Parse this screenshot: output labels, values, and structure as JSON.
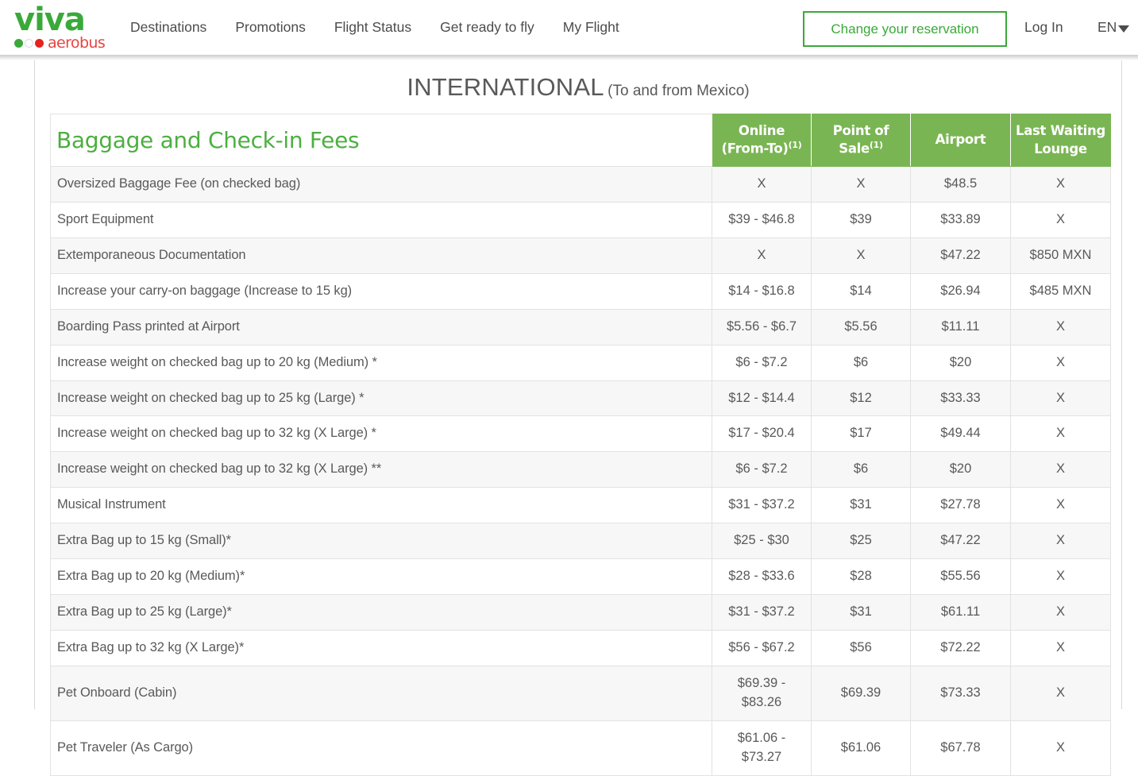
{
  "brand": {
    "logo_word": "viva",
    "logo_sub": "aerobus",
    "logo_green": "#3aa93a",
    "logo_red": "#e8433f"
  },
  "header": {
    "nav": [
      {
        "label": "Destinations",
        "name": "nav-destinations"
      },
      {
        "label": "Promotions",
        "name": "nav-promotions"
      },
      {
        "label": "Flight Status",
        "name": "nav-flight-status"
      },
      {
        "label": "Get ready to fly",
        "name": "nav-get-ready-to-fly"
      },
      {
        "label": "My Flight",
        "name": "nav-my-flight"
      }
    ],
    "change_reservation": "Change your reservation",
    "login": "Log In",
    "language": "EN"
  },
  "page": {
    "title_main": "INTERNATIONAL",
    "title_sub": "(To and from Mexico)"
  },
  "table": {
    "caption": "Baggage and Check-in Fees",
    "accent_green": "#7ab553",
    "title_green": "#4caf41",
    "columns": [
      {
        "line1": "Online",
        "line2": "(From-To)",
        "sup": "(1)"
      },
      {
        "line1": "Point of Sale",
        "line2": "",
        "sup": "(1)"
      },
      {
        "line1": "Airport",
        "line2": "",
        "sup": ""
      },
      {
        "line1": "Last Waiting",
        "line2": "Lounge",
        "sup": ""
      }
    ],
    "rows": [
      {
        "label": "Oversized Baggage Fee (on checked bag)",
        "online": "X",
        "point_of_sale": "X",
        "airport": "$48.5",
        "last_waiting_lounge": "X"
      },
      {
        "label": "Sport Equipment",
        "online": "$39 - $46.8",
        "point_of_sale": "$39",
        "airport": "$33.89",
        "last_waiting_lounge": "X"
      },
      {
        "label": "Extemporaneous Documentation",
        "online": "X",
        "point_of_sale": "X",
        "airport": "$47.22",
        "last_waiting_lounge": "$850 MXN"
      },
      {
        "label": "Increase your carry-on baggage (Increase to 15 kg)",
        "online": "$14 - $16.8",
        "point_of_sale": "$14",
        "airport": "$26.94",
        "last_waiting_lounge": "$485 MXN"
      },
      {
        "label": "Boarding Pass printed at Airport",
        "online": "$5.56 - $6.7",
        "point_of_sale": "$5.56",
        "airport": "$11.11",
        "last_waiting_lounge": "X"
      },
      {
        "label": "Increase weight on checked bag up to 20 kg (Medium) *",
        "online": "$6 - $7.2",
        "point_of_sale": "$6",
        "airport": "$20",
        "last_waiting_lounge": "X"
      },
      {
        "label": "Increase weight on checked bag up to 25 kg (Large) *",
        "online": "$12 - $14.4",
        "point_of_sale": "$12",
        "airport": "$33.33",
        "last_waiting_lounge": "X"
      },
      {
        "label": "Increase weight on checked bag up to 32 kg (X Large) *",
        "online": "$17 - $20.4",
        "point_of_sale": "$17",
        "airport": "$49.44",
        "last_waiting_lounge": "X"
      },
      {
        "label": "Increase weight on checked bag up to 32 kg (X Large) **",
        "online": "$6 - $7.2",
        "point_of_sale": "$6",
        "airport": "$20",
        "last_waiting_lounge": "X"
      },
      {
        "label": "Musical Instrument",
        "online": "$31 - $37.2",
        "point_of_sale": "$31",
        "airport": "$27.78",
        "last_waiting_lounge": "X"
      },
      {
        "label": "Extra Bag up to 15 kg (Small)*",
        "online": "$25 - $30",
        "point_of_sale": "$25",
        "airport": "$47.22",
        "last_waiting_lounge": "X"
      },
      {
        "label": "Extra Bag up to 20 kg (Medium)*",
        "online": "$28 - $33.6",
        "point_of_sale": "$28",
        "airport": "$55.56",
        "last_waiting_lounge": "X"
      },
      {
        "label": "Extra Bag up to 25 kg (Large)*",
        "online": "$31 - $37.2",
        "point_of_sale": "$31",
        "airport": "$61.11",
        "last_waiting_lounge": "X"
      },
      {
        "label": "Extra Bag up to 32 kg (X Large)*",
        "online": "$56 - $67.2",
        "point_of_sale": "$56",
        "airport": "$72.22",
        "last_waiting_lounge": "X"
      },
      {
        "label": "Pet Onboard (Cabin)",
        "online": "$69.39 - $83.26",
        "point_of_sale": "$69.39",
        "airport": "$73.33",
        "last_waiting_lounge": "X",
        "tall": true
      },
      {
        "label": "Pet Traveler (As Cargo)",
        "online": "$61.06 - $73.27",
        "point_of_sale": "$61.06",
        "airport": "$67.78",
        "last_waiting_lounge": "X",
        "tall": true
      }
    ]
  }
}
